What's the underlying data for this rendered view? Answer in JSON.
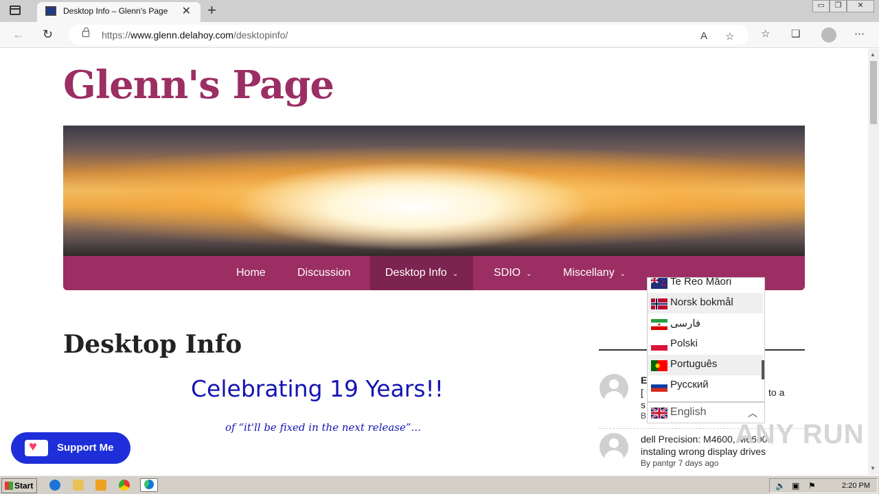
{
  "browser": {
    "tab_title": "Desktop Info – Glenn's Page",
    "url_prefix": "https://",
    "url_host": "www.glenn.delahoy.com",
    "url_path": "/desktopinfo/"
  },
  "site": {
    "title": "Glenn's Page",
    "nav": [
      {
        "label": "Home",
        "has_submenu": false,
        "active": false
      },
      {
        "label": "Discussion",
        "has_submenu": false,
        "active": false
      },
      {
        "label": "Desktop Info",
        "has_submenu": true,
        "active": true
      },
      {
        "label": "SDIO",
        "has_submenu": true,
        "active": false
      },
      {
        "label": "Miscellany",
        "has_submenu": true,
        "active": false
      }
    ]
  },
  "main": {
    "heading": "Desktop Info",
    "celebrate": "Celebrating 19 Years!!",
    "subline": "of “it'll be fixed in the next release”..."
  },
  "sidebar": {
    "comments": [
      {
        "title": "E",
        "line1": "[",
        "line2": "s",
        "meta": "B",
        "trailing": "to a"
      },
      {
        "title": "dell Precision: M4600, M6600",
        "line1": "instaling wrong display drives",
        "meta": "By pantgr 7 days ago"
      }
    ]
  },
  "support": {
    "label": "Support Me"
  },
  "language_picker": {
    "options": [
      "Te Reo Māori",
      "Norsk bokmål",
      "فارسی",
      "Polski",
      "Português",
      "Русский"
    ],
    "current": "English"
  },
  "watermark": "ANY RUN",
  "taskbar": {
    "start_label": "Start",
    "clock": "2:20 PM"
  }
}
